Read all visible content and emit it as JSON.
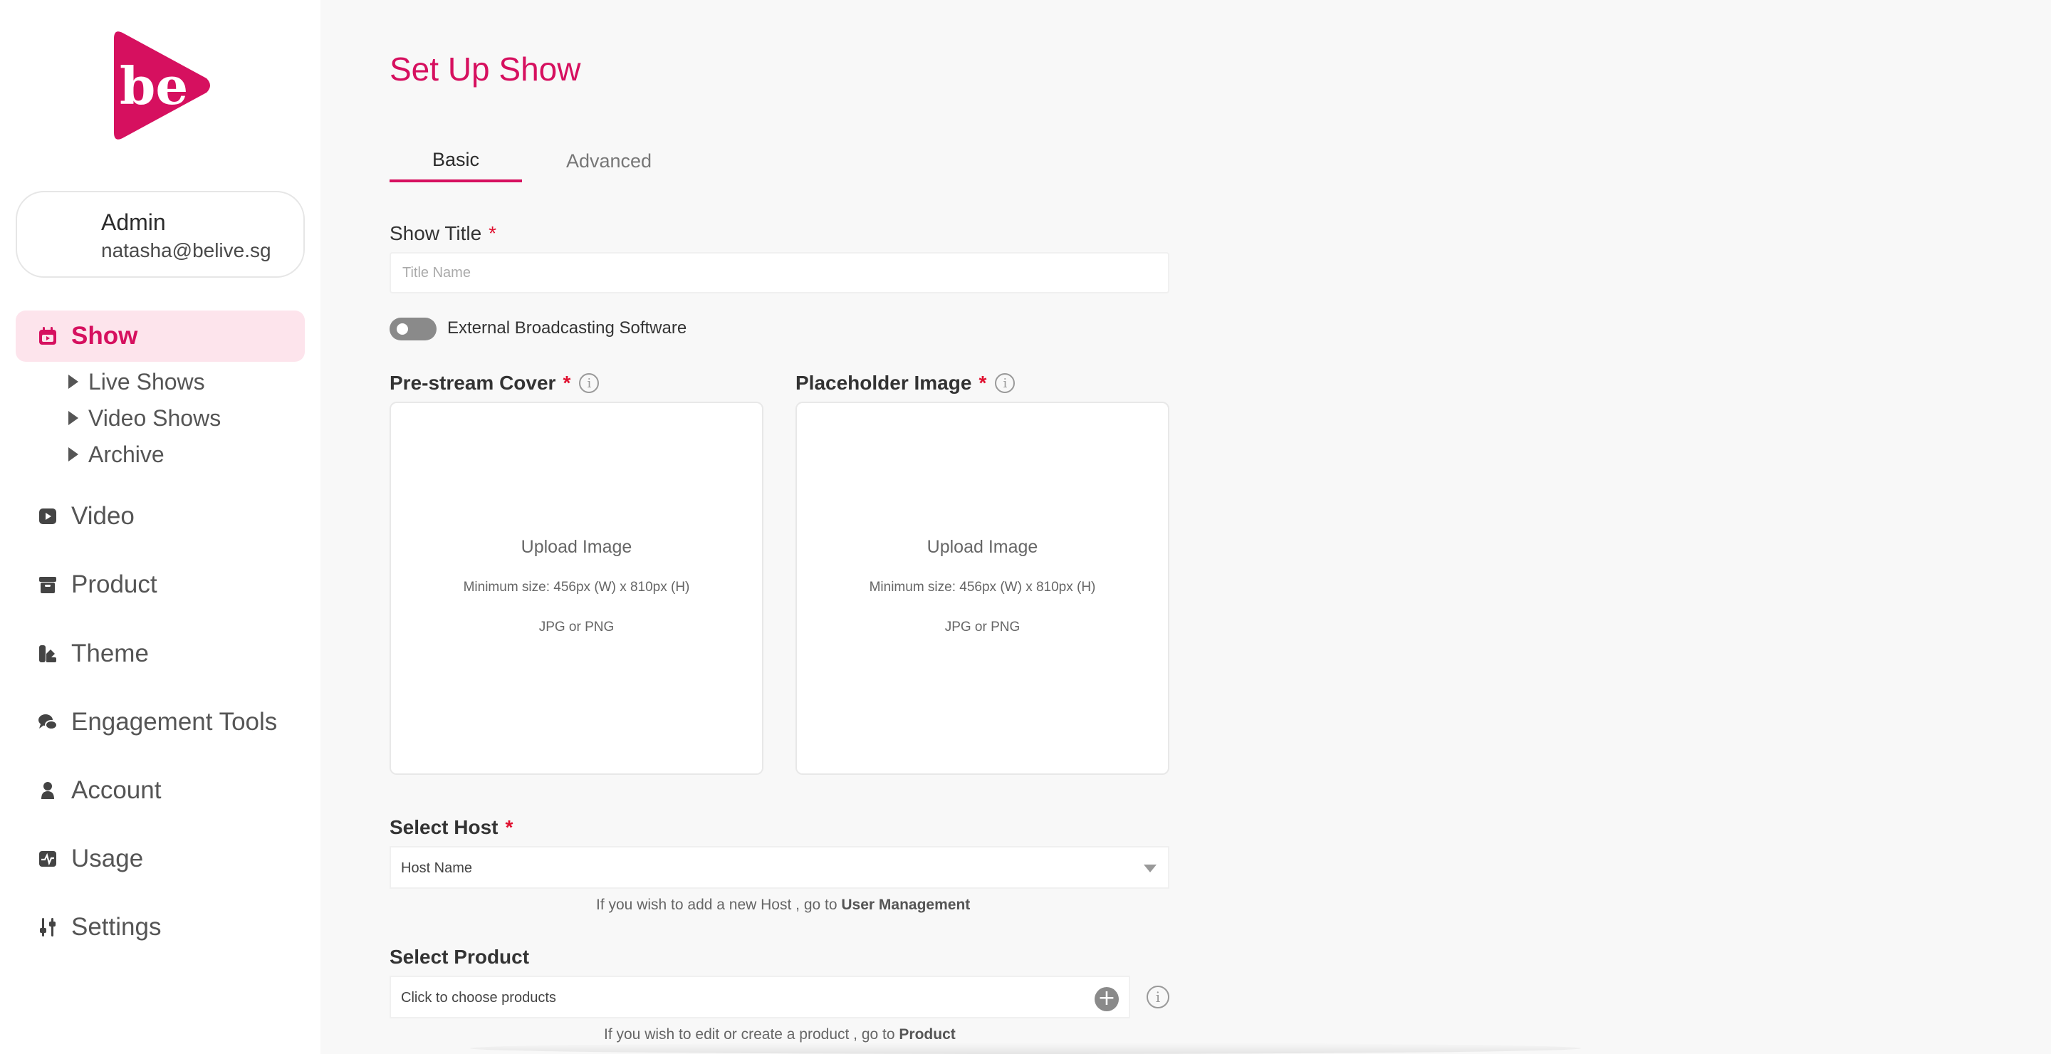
{
  "app": {
    "logo_text": "be",
    "brand_color": "#d6105f"
  },
  "profile": {
    "role": "Admin",
    "email": "natasha@belive.sg"
  },
  "sidebar": {
    "items": [
      {
        "label": "Show",
        "icon": "calendar-icon",
        "active": true
      },
      {
        "label": "Video",
        "icon": "play-icon"
      },
      {
        "label": "Product",
        "icon": "box-icon"
      },
      {
        "label": "Theme",
        "icon": "palette-icon"
      },
      {
        "label": "Engagement Tools",
        "icon": "chat-icon"
      },
      {
        "label": "Account",
        "icon": "user-icon"
      },
      {
        "label": "Usage",
        "icon": "pulse-icon"
      },
      {
        "label": "Settings",
        "icon": "sliders-icon"
      }
    ],
    "subitems": [
      {
        "label": "Live Shows"
      },
      {
        "label": "Video Shows"
      },
      {
        "label": "Archive"
      }
    ]
  },
  "main": {
    "title": "Set Up Show",
    "tabs": [
      {
        "label": "Basic",
        "active": true
      },
      {
        "label": "Advanced"
      }
    ],
    "show_title": {
      "label": "Show Title",
      "required_mark": "*",
      "placeholder": "Title Name",
      "value": ""
    },
    "external_broadcast": {
      "label": "External Broadcasting Software",
      "enabled": false
    },
    "prestream_cover": {
      "label": "Pre-stream Cover",
      "required_mark": "*",
      "info": "i",
      "upload_title": "Upload Image",
      "min_size": "Minimum size: 456px (W) x 810px (H)",
      "format": "JPG or PNG"
    },
    "placeholder_image": {
      "label": "Placeholder Image",
      "required_mark": "*",
      "info": "i",
      "upload_title": "Upload Image",
      "min_size": "Minimum size: 456px (W) x 810px (H)",
      "format": "JPG or PNG"
    },
    "select_host": {
      "label": "Select Host",
      "required_mark": "*",
      "value": "Host Name",
      "hint_prefix": "If you wish to add a new Host , go to",
      "hint_link": "User Management"
    },
    "select_product": {
      "label": "Select Product",
      "placeholder": "Click to choose products",
      "add_symbol": "+",
      "info": "i",
      "hint_prefix": "If you wish to edit or create a product , go to",
      "hint_link": "Product"
    }
  }
}
